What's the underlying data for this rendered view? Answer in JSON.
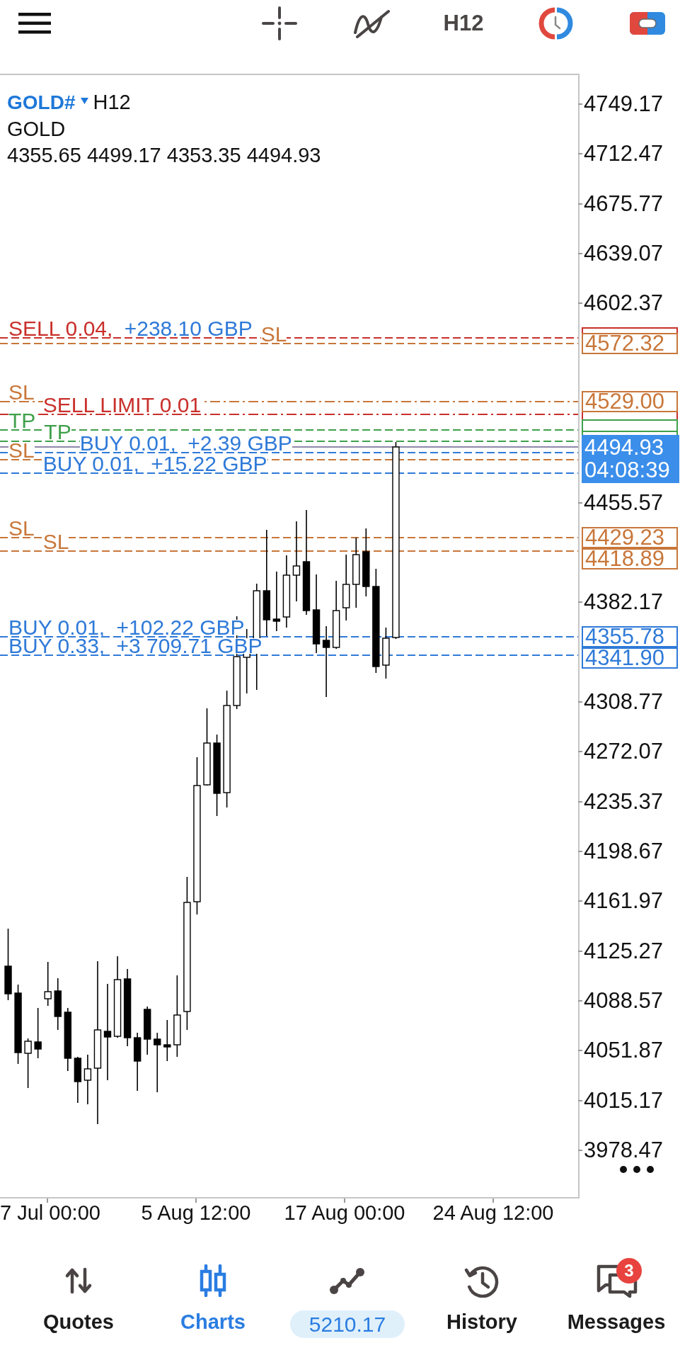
{
  "toolbar": {
    "timeframe": "H12"
  },
  "chart": {
    "symbol": "GOLD#",
    "timeframe": "H12",
    "description": "GOLD",
    "ohlc": "4355.65 4499.17 4353.35 4494.93",
    "price_axis": [
      "4749.17",
      "4712.47",
      "4675.77",
      "4639.07",
      "4602.37",
      "4455.57",
      "4382.17",
      "4308.77",
      "4272.07",
      "4235.37",
      "4198.67",
      "4161.97",
      "4125.27",
      "4088.57",
      "4051.87",
      "4015.17",
      "3978.47"
    ],
    "time_axis": [
      "7 Jul 00:00",
      "5 Aug 12:00",
      "17 Aug 00:00",
      "24 Aug 12:00"
    ],
    "order_lines": [
      {
        "color": "#c9302c",
        "label": "SELL 0.04,",
        "profit": "+238.10 GBP"
      },
      {
        "color": "#c8773a",
        "label": "SL",
        "price_tag": "4572.32"
      },
      {
        "color": "#c8773a",
        "label": "SL",
        "price_tag": "4529.00"
      },
      {
        "color": "#c9302c",
        "label": "SELL LIMIT 0.01"
      },
      {
        "color": "#3fa04b",
        "label": "TP"
      },
      {
        "color": "#3fa04b",
        "label": "TP"
      },
      {
        "color": "#2f7ad8",
        "label": "BUY 0.01,",
        "profit": "+2.39 GBP"
      },
      {
        "color": "#c8773a",
        "label": "SL"
      },
      {
        "color": "#2f7ad8",
        "label": "BUY 0.01,",
        "profit": "+15.22 GBP"
      },
      {
        "color": "#c8773a",
        "label": "SL",
        "price_tag": "4429.23"
      },
      {
        "color": "#c8773a",
        "label": "SL",
        "price_tag": "4418.89"
      },
      {
        "color": "#2f7ad8",
        "label": "BUY 0.01,",
        "profit": "+102.22 GBP",
        "price_tag": "4355.78"
      },
      {
        "color": "#2f7ad8",
        "label": "BUY 0.33,",
        "profit": "+3 709.71 GBP",
        "price_tag": "4341.90"
      }
    ],
    "current_price": {
      "price": "4494.93",
      "countdown": "04:08:39"
    }
  },
  "nav": [
    {
      "kind": "tab",
      "label": "Quotes",
      "selected": false
    },
    {
      "kind": "tab",
      "label": "Charts",
      "selected": true
    },
    {
      "kind": "balance",
      "label": "5210.17",
      "selected": false
    },
    {
      "kind": "tab",
      "label": "History",
      "selected": false
    },
    {
      "kind": "tab",
      "label": "Messages",
      "selected": false,
      "badge": "3"
    }
  ]
}
